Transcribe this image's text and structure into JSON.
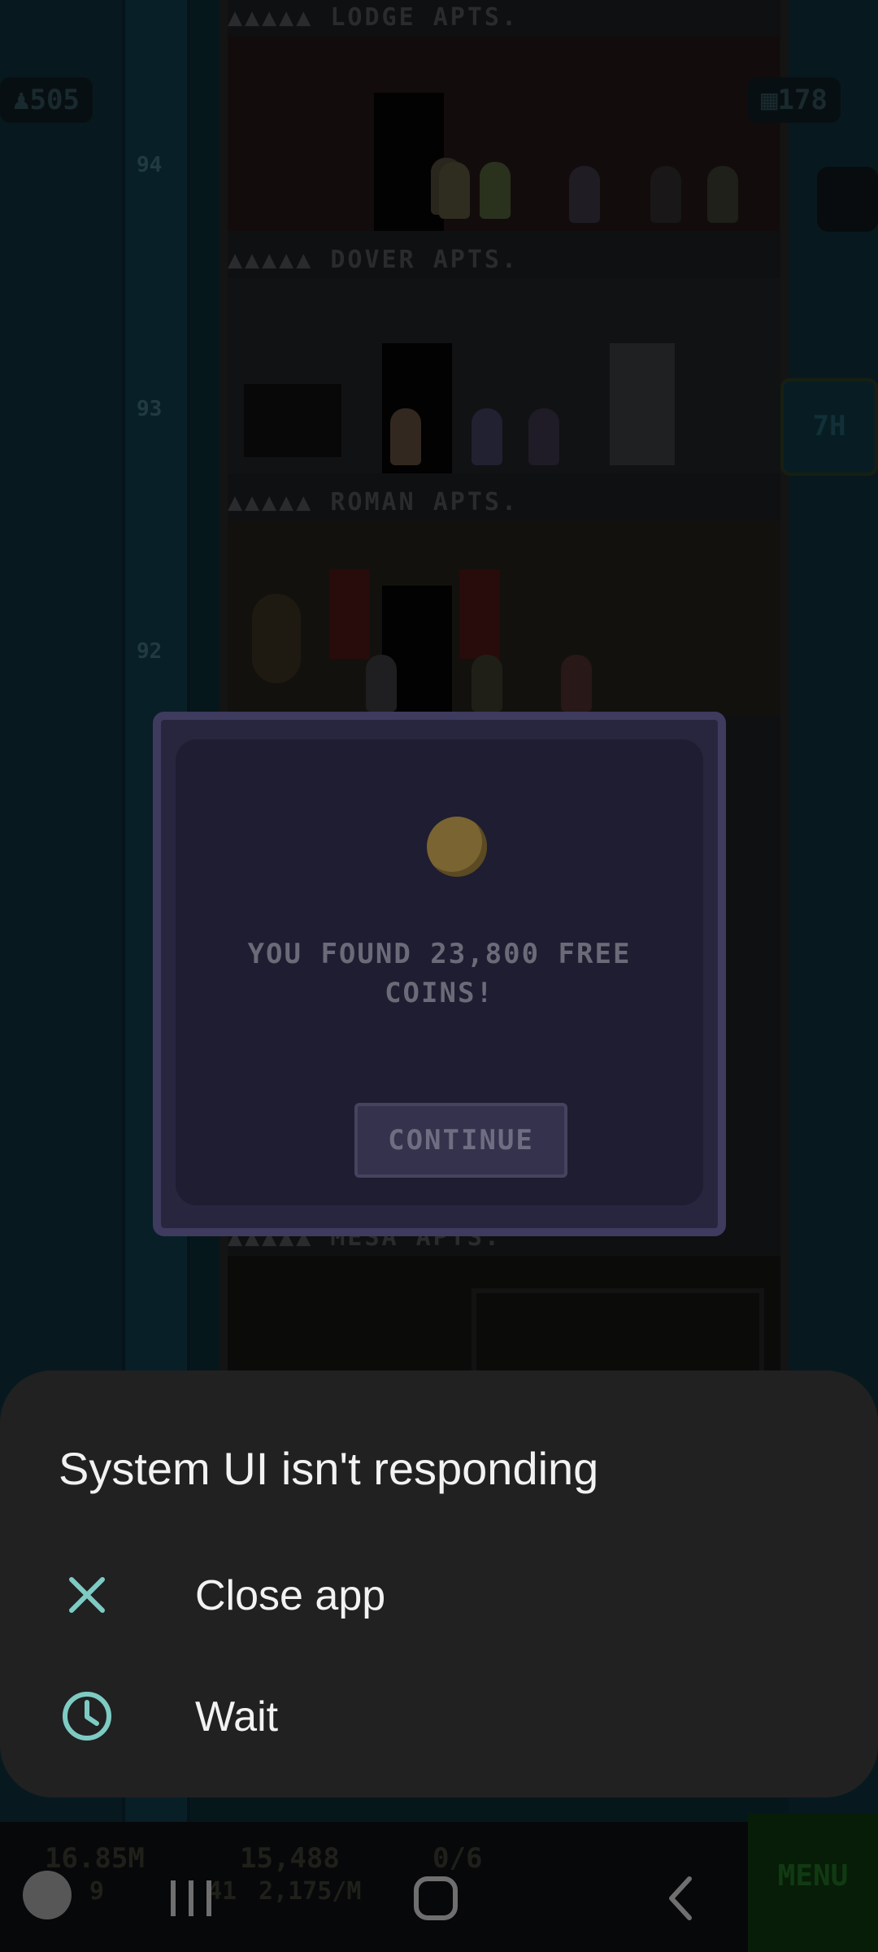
{
  "game": {
    "floors": [
      {
        "label": "▲▲▲▲▲ LODGE APTS.",
        "number": ""
      },
      {
        "label": "▲▲▲▲▲ DOVER APTS.",
        "number": "94"
      },
      {
        "label": "▲▲▲▲▲ ROMAN APTS.",
        "number": "93"
      },
      {
        "label": "",
        "number": "92"
      }
    ],
    "population": "505",
    "bux": "178",
    "timer_badge": "7H",
    "bottom_coins": "16.85M",
    "bottom_bux": "15,488",
    "bottom_vip": "0/6",
    "bottom_level": "9",
    "bottom_income": "2,175/M",
    "bottom_lvl2": "41",
    "menu_label": "MENU",
    "partial_floor_label": "▲▲▲▲▲ MESA APTS."
  },
  "popup": {
    "message": "YOU FOUND 23,800 FREE COINS!",
    "continue_label": "CONTINUE"
  },
  "dialog": {
    "title": "System UI isn't responding",
    "options": [
      {
        "label": "Close app",
        "icon": "close-icon"
      },
      {
        "label": "Wait",
        "icon": "clock-icon"
      }
    ],
    "accent_color": "#7ecbc4"
  },
  "navbar": {
    "icons": [
      "recent-apps-icon",
      "home-icon",
      "back-icon"
    ]
  }
}
